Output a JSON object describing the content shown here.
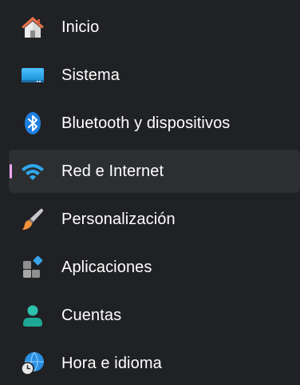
{
  "sidebar": {
    "selected_indicator_color": "#f0a6f0",
    "items": [
      {
        "label": "Inicio",
        "icon": "home-icon"
      },
      {
        "label": "Sistema",
        "icon": "system-monitor-icon"
      },
      {
        "label": "Bluetooth y dispositivos",
        "icon": "bluetooth-icon"
      },
      {
        "label": "Red e Internet",
        "icon": "wifi-icon",
        "selected": true
      },
      {
        "label": "Personalización",
        "icon": "paintbrush-icon"
      },
      {
        "label": "Aplicaciones",
        "icon": "apps-icon"
      },
      {
        "label": "Cuentas",
        "icon": "account-icon"
      },
      {
        "label": "Hora e idioma",
        "icon": "time-language-icon"
      }
    ]
  }
}
